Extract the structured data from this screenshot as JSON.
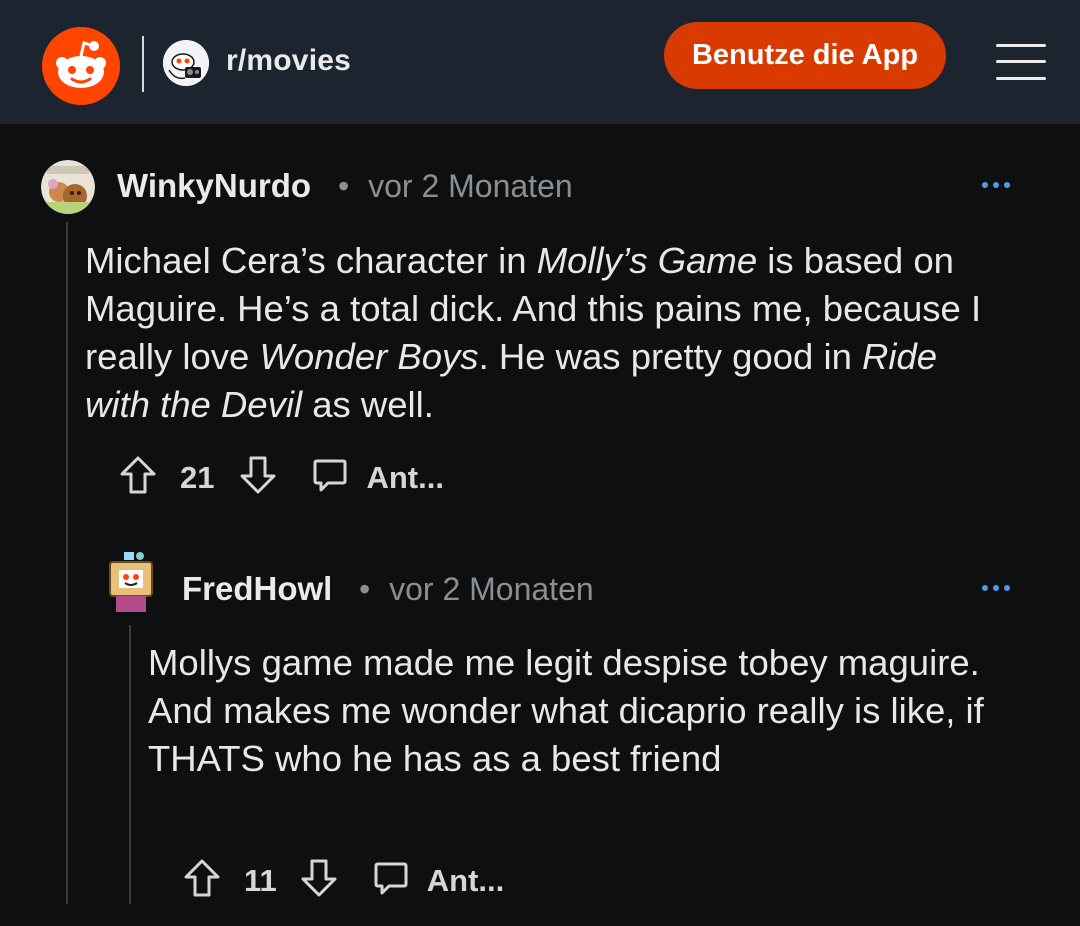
{
  "header": {
    "subreddit": "r/movies",
    "app_button": "Benutze die App",
    "colors": {
      "bg": "#1c2430",
      "accent": "#d93a00",
      "logo": "#ff4500"
    }
  },
  "comments": [
    {
      "username": "WinkyNurdo",
      "separator": "•",
      "time": "vor 2 Monaten",
      "avatar_icon": "user-avatar-icon",
      "body_parts": [
        {
          "text": "Michael Cera’s character in ",
          "italic": false
        },
        {
          "text": "Molly’s Game",
          "italic": true
        },
        {
          "text": " is based on Maguire. He’s a total dick. And this pains me, because I really love ",
          "italic": false
        },
        {
          "text": "Wonder Boys",
          "italic": true
        },
        {
          "text": ". He was pretty good in ",
          "italic": false
        },
        {
          "text": "Ride with the Devil",
          "italic": true
        },
        {
          "text": " as well.",
          "italic": false
        }
      ],
      "score": "21",
      "reply_label": "Ant..."
    },
    {
      "username": "FredHowl",
      "separator": "•",
      "time": "vor 2 Monaten",
      "avatar_icon": "robot-avatar-icon",
      "body": "Mollys game made me legit despise tobey maguire. And makes me wonder what dicaprio really is like, if THATS who he has as a best friend",
      "score": "11",
      "reply_label": "Ant..."
    }
  ]
}
